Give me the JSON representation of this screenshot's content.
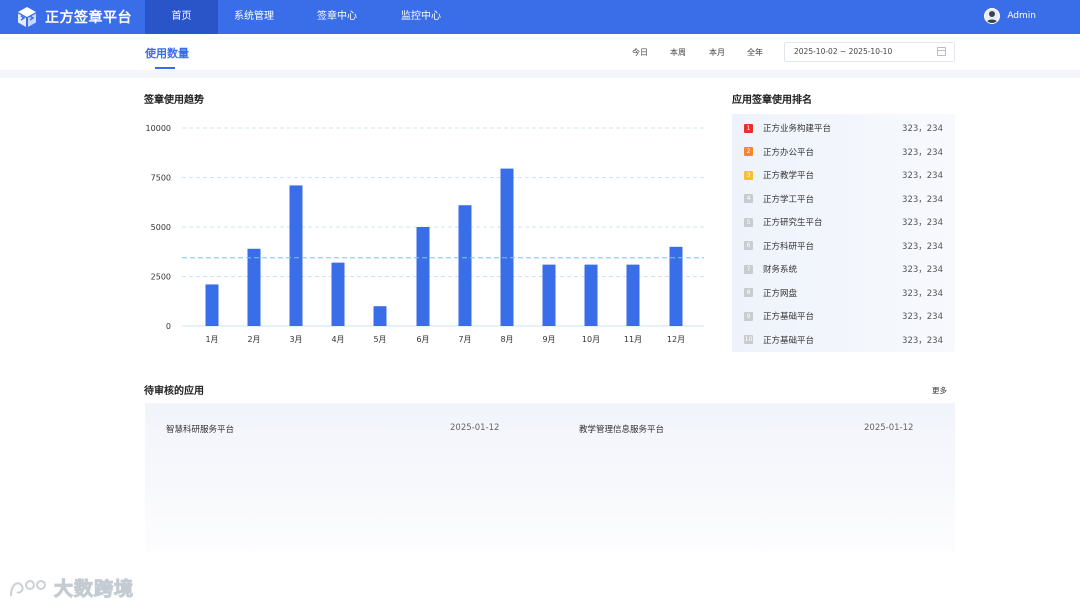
{
  "header": {
    "brand": "正方签章平台",
    "nav": [
      {
        "label": "首页",
        "active": true
      },
      {
        "label": "系统管理",
        "active": false
      },
      {
        "label": "签章中心",
        "active": false
      },
      {
        "label": "监控中心",
        "active": false
      }
    ],
    "user": "Admin",
    "colors": {
      "bar": "#3a6ee8",
      "active": "#2a55c8"
    }
  },
  "subheader": {
    "tab": "使用数量",
    "periods": [
      "今日",
      "本周",
      "本月",
      "全年"
    ],
    "date_range": "2025-10-02 ~ 2025-10-10"
  },
  "usage_trend": {
    "title": "签章使用趋势"
  },
  "chart_data": {
    "type": "bar",
    "categories": [
      "1月",
      "2月",
      "3月",
      "4月",
      "5月",
      "6月",
      "7月",
      "8月",
      "9月",
      "10月",
      "11月",
      "12月"
    ],
    "values": [
      2100,
      3900,
      7100,
      3200,
      1000,
      5000,
      6100,
      7950,
      3100,
      3100,
      3100,
      4000
    ],
    "yticks": [
      "0",
      "2500",
      "5000",
      "7500",
      "10000"
    ],
    "ylim": [
      0,
      10000
    ],
    "reference_line": 3450,
    "grid": true,
    "color": "#3a6ee8"
  },
  "ranking": {
    "title": "应用签章使用排名",
    "items": [
      {
        "rank": "1",
        "name": "正方业务构建平台",
        "value": "323，234",
        "color": "#e5322d"
      },
      {
        "rank": "2",
        "name": "正方办公平台",
        "value": "323，234",
        "color": "#f08a24"
      },
      {
        "rank": "3",
        "name": "正方教学平台",
        "value": "323，234",
        "color": "#f5c228"
      },
      {
        "rank": "4",
        "name": "正方学工平台",
        "value": "323，234",
        "color": "#c8ccd2"
      },
      {
        "rank": "5",
        "name": "正方研究生平台",
        "value": "323，234",
        "color": "#c8ccd2"
      },
      {
        "rank": "6",
        "name": "正方科研平台",
        "value": "323，234",
        "color": "#c8ccd2"
      },
      {
        "rank": "7",
        "name": "财务系统",
        "value": "323，234",
        "color": "#c8ccd2"
      },
      {
        "rank": "8",
        "name": "正方网盘",
        "value": "323，234",
        "color": "#c8ccd2"
      },
      {
        "rank": "9",
        "name": "正方基础平台",
        "value": "323，234",
        "color": "#c8ccd2"
      },
      {
        "rank": "10",
        "name": "正方基础平台",
        "value": "323，234",
        "color": "#c8ccd2"
      }
    ]
  },
  "pending": {
    "title": "待审核的应用",
    "more": "更多",
    "items": [
      {
        "name": "智慧科研服务平台",
        "date": "2025-01-12"
      },
      {
        "name": "教学管理信息服务平台",
        "date": "2025-01-12"
      }
    ]
  },
  "watermark": {
    "text": "大数跨境"
  }
}
